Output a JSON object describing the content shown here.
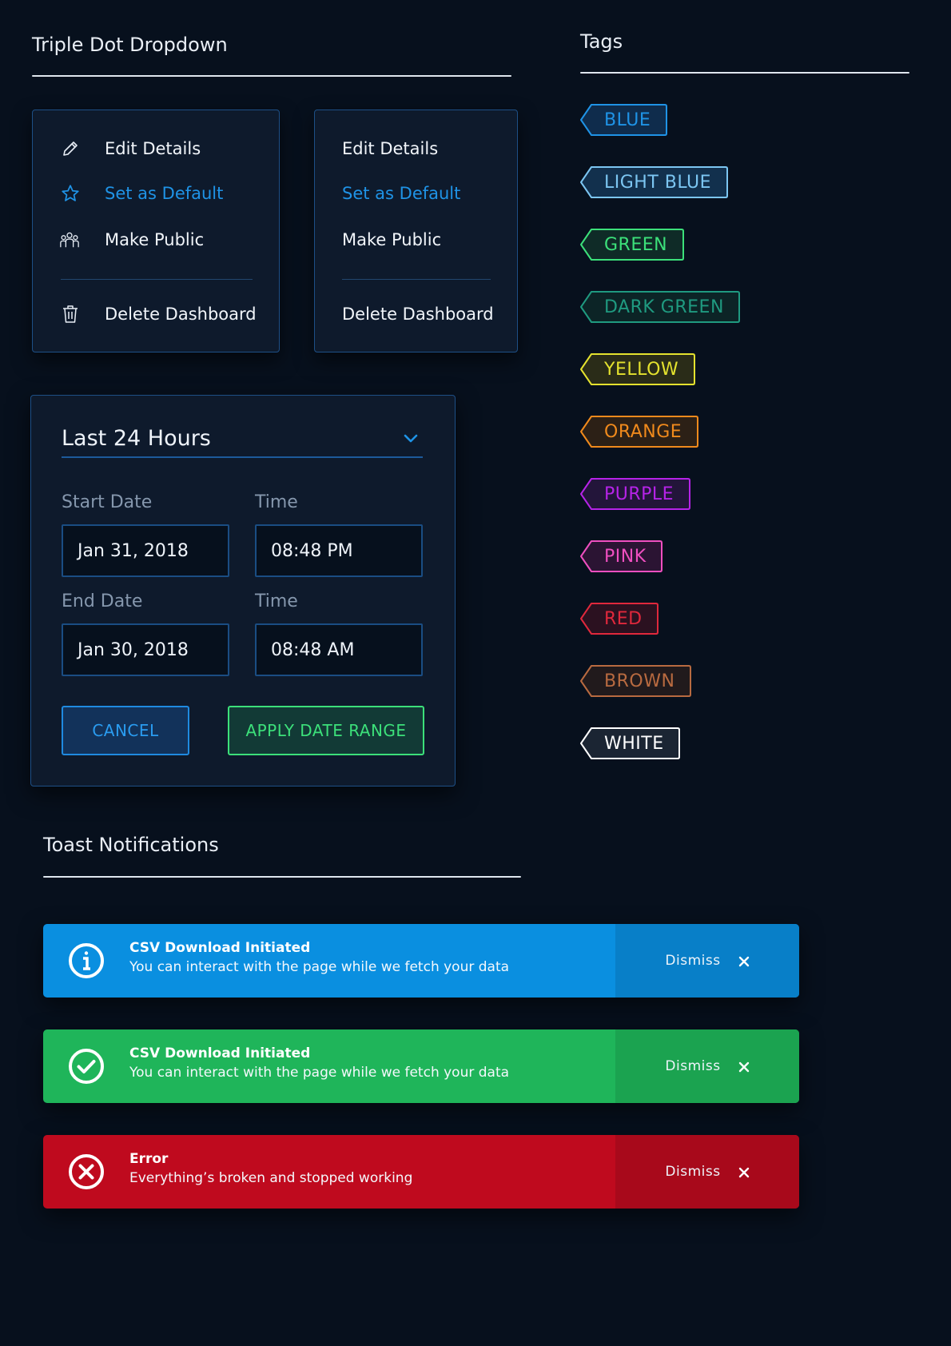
{
  "dropdown_section": {
    "title": "Triple Dot Dropdown",
    "menu_with_icons": {
      "items": [
        {
          "label": "Edit Details",
          "icon": "pencil-icon",
          "active": false
        },
        {
          "label": "Set as Default",
          "icon": "star-icon",
          "active": true
        },
        {
          "label": "Make Public",
          "icon": "people-icon",
          "active": false
        },
        {
          "label": "Delete Dashboard",
          "icon": "trash-icon",
          "active": false
        }
      ]
    },
    "menu_plain": {
      "items": [
        {
          "label": "Edit Details",
          "active": false
        },
        {
          "label": "Set as Default",
          "active": true
        },
        {
          "label": "Make Public",
          "active": false
        },
        {
          "label": "Delete Dashboard",
          "active": false
        }
      ]
    }
  },
  "date_range": {
    "selected_range": "Last 24 Hours",
    "start_date_label": "Start Date",
    "start_date": "Jan 31, 2018",
    "start_time_label": "Time",
    "start_time": "08:48 PM",
    "end_date_label": "End Date",
    "end_date": "Jan 30, 2018",
    "end_time_label": "Time",
    "end_time": "08:48 AM",
    "cancel_label": "CANCEL",
    "apply_label": "APPLY DATE RANGE"
  },
  "tags_section": {
    "title": "Tags",
    "tags": [
      {
        "label": "BLUE",
        "color": "#1f93e6",
        "fill": "#0f2c4c"
      },
      {
        "label": "LIGHT BLUE",
        "color": "#7cc6f2",
        "fill": "#12304d"
      },
      {
        "label": "GREEN",
        "color": "#3ce07a",
        "fill": "#0f2b27"
      },
      {
        "label": "DARK GREEN",
        "color": "#1f9a80",
        "fill": "#0c2426"
      },
      {
        "label": "YELLOW",
        "color": "#e4e22e",
        "fill": "#2a2c18"
      },
      {
        "label": "ORANGE",
        "color": "#f08a1c",
        "fill": "#2c2016"
      },
      {
        "label": "PURPLE",
        "color": "#b623e8",
        "fill": "#23153a"
      },
      {
        "label": "PINK",
        "color": "#ef4fc0",
        "fill": "#2b1433"
      },
      {
        "label": "RED",
        "color": "#e0283c",
        "fill": "#2b1120"
      },
      {
        "label": "BROWN",
        "color": "#b86a40",
        "fill": "#211a1c"
      },
      {
        "label": "WHITE",
        "color": "#ffffff",
        "fill": "#1b2533"
      }
    ]
  },
  "toast_section": {
    "title": "Toast Notifications",
    "toasts": [
      {
        "type": "info",
        "icon": "info-icon",
        "title": "CSV Download Initiated",
        "message": "You can interact with the page while we fetch your data",
        "dismiss": "Dismiss",
        "color": "#0a8fe0",
        "dismiss_color": "#087fc8"
      },
      {
        "type": "success",
        "icon": "check-circle-icon",
        "title": "CSV Download Initiated",
        "message": "You can interact with the page while we fetch your data",
        "dismiss": "Dismiss",
        "color": "#1fb55a",
        "dismiss_color": "#1ba350"
      },
      {
        "type": "error",
        "icon": "error-circle-icon",
        "title": "Error",
        "message": "Everything’s broken and stopped working",
        "dismiss": "Dismiss",
        "color": "#bf0a1e",
        "dismiss_color": "#a8091b"
      }
    ]
  }
}
